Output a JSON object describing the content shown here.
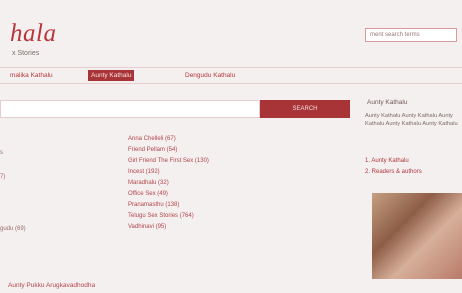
{
  "header": {
    "logo": "hala",
    "tagline": "x Stories",
    "search_placeholder": "ment search terms"
  },
  "nav": [
    {
      "label": "malika Kathalu",
      "active": false
    },
    {
      "label": "Aunty Kathalu",
      "active": true
    },
    {
      "label": "Dengudu Kathalu",
      "active": false
    }
  ],
  "search": {
    "button_label": "SEARCH"
  },
  "categories_left": [
    "s",
    "7)",
    "gudu (69)"
  ],
  "categories_right": [
    "Anna Chelleli (67)",
    "Friend Pellam (54)",
    "Girl Friend The First Sex (130)",
    "Incest (192)",
    "Maradhalu (32)",
    "Office Sex (49)",
    "Pranamasthu (138)",
    "Telugu Sex Stories (764)",
    "Vadhinavi (95)"
  ],
  "sidebar": {
    "title": "Aunty Kathalu",
    "paragraph": "Aunty Kathalu Aunty Kathalu Aunty Kathalu Aunty Kathalu Aunty Kathalu",
    "links": [
      "1. Aunty Kathalu",
      "2. Readers & authors"
    ]
  },
  "post": {
    "title": "Aunty Pukku Arugkavadhodha"
  }
}
